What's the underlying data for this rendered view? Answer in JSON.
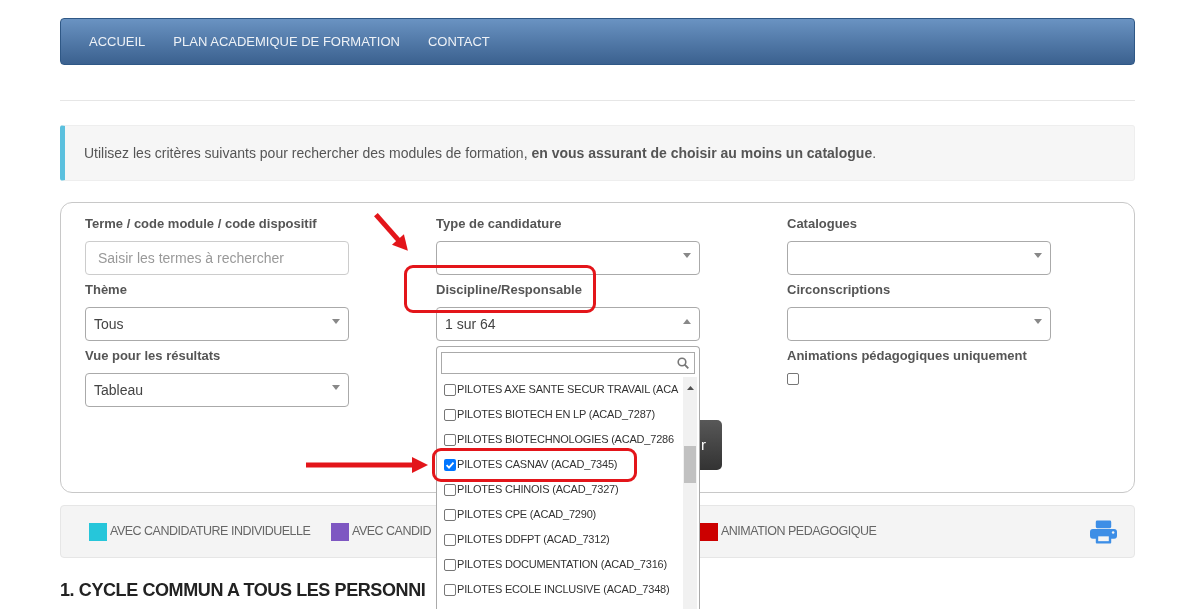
{
  "nav": {
    "items": [
      {
        "label": "ACCUEIL"
      },
      {
        "label": "PLAN ACADEMIQUE DE FORMATION"
      },
      {
        "label": "CONTACT"
      }
    ]
  },
  "info": {
    "text": "Utilisez les critères suivants pour rechercher des modules de formation, **en vous assurant de choisir au moins un catalogue**."
  },
  "search_form": {
    "columns": [
      [
        {
          "kind": "text",
          "label": "Terme / code module / code dispositif",
          "placeholder": "Saisir les termes à rechercher",
          "highlighted": false
        },
        {
          "kind": "select",
          "label": "Thème",
          "value": "Tous",
          "expanded": false,
          "highlighted": false
        },
        {
          "kind": "select",
          "label": "Vue pour les résultats",
          "value": "Tableau",
          "expanded": false,
          "highlighted": false
        }
      ],
      [
        {
          "kind": "select",
          "label": "Type de candidature",
          "expanded": false,
          "highlighted": false
        },
        {
          "kind": "select",
          "label": "Discipline/Responsable",
          "value": "1 sur 64",
          "expanded": true,
          "highlighted": true,
          "options": [
            {
              "label": "PILOTES AXE SANTE SECUR TRAVAIL (ACA",
              "checked": false,
              "highlighted": false
            },
            {
              "label": "PILOTES BIOTECH EN LP (ACAD_7287)",
              "checked": false,
              "highlighted": false
            },
            {
              "label": "PILOTES BIOTECHNOLOGIES (ACAD_7286",
              "checked": false,
              "highlighted": false
            },
            {
              "label": "PILOTES CASNAV (ACAD_7345)",
              "checked": true,
              "highlighted": true
            },
            {
              "label": "PILOTES CHINOIS (ACAD_7327)",
              "checked": false,
              "highlighted": false
            },
            {
              "label": "PILOTES CPE (ACAD_7290)",
              "checked": false,
              "highlighted": false
            },
            {
              "label": "PILOTES DDFPT (ACAD_7312)",
              "checked": false,
              "highlighted": false
            },
            {
              "label": "PILOTES DOCUMENTATION (ACAD_7316)",
              "checked": false,
              "highlighted": false
            },
            {
              "label": "PILOTES ECOLE INCLUSIVE (ACAD_7348)",
              "checked": false,
              "highlighted": false
            }
          ]
        }
      ],
      [
        {
          "kind": "select",
          "label": "Catalogues",
          "expanded": false,
          "highlighted": false
        },
        {
          "kind": "select",
          "label": "Circonscriptions",
          "expanded": false,
          "highlighted": false
        },
        {
          "kind": "checkbox",
          "label": "Animations pédagogiques uniquement",
          "checked": false,
          "highlighted": false
        }
      ]
    ],
    "submit_button": {
      "label": "r"
    }
  },
  "legend": {
    "items": [
      {
        "label": "AVEC CANDIDATURE INDIVIDUELLE",
        "color": "#26c6da"
      },
      {
        "label": "AVEC CANDID",
        "color": "#7e57c2"
      },
      {
        "label": "ANIMATION PEDAGOGIQUE",
        "color": "#cc0000"
      }
    ]
  },
  "section_heading": {
    "text": "1. CYCLE COMMUN A TOUS LES PERSONNI"
  }
}
